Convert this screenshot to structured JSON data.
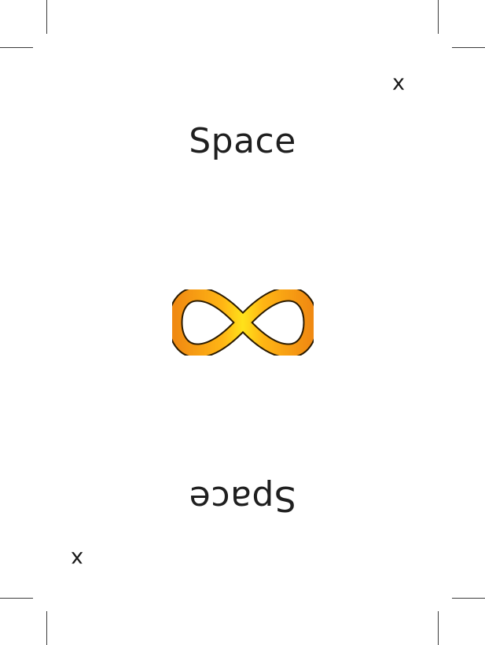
{
  "card": {
    "name": "Space",
    "corner_symbol": "x",
    "center_icon": "infinity-icon",
    "colors": {
      "icon_outer": "#f08a12",
      "icon_inner": "#ffe21a",
      "icon_outline": "#2a1a00",
      "text": "#1f1f1f"
    }
  }
}
